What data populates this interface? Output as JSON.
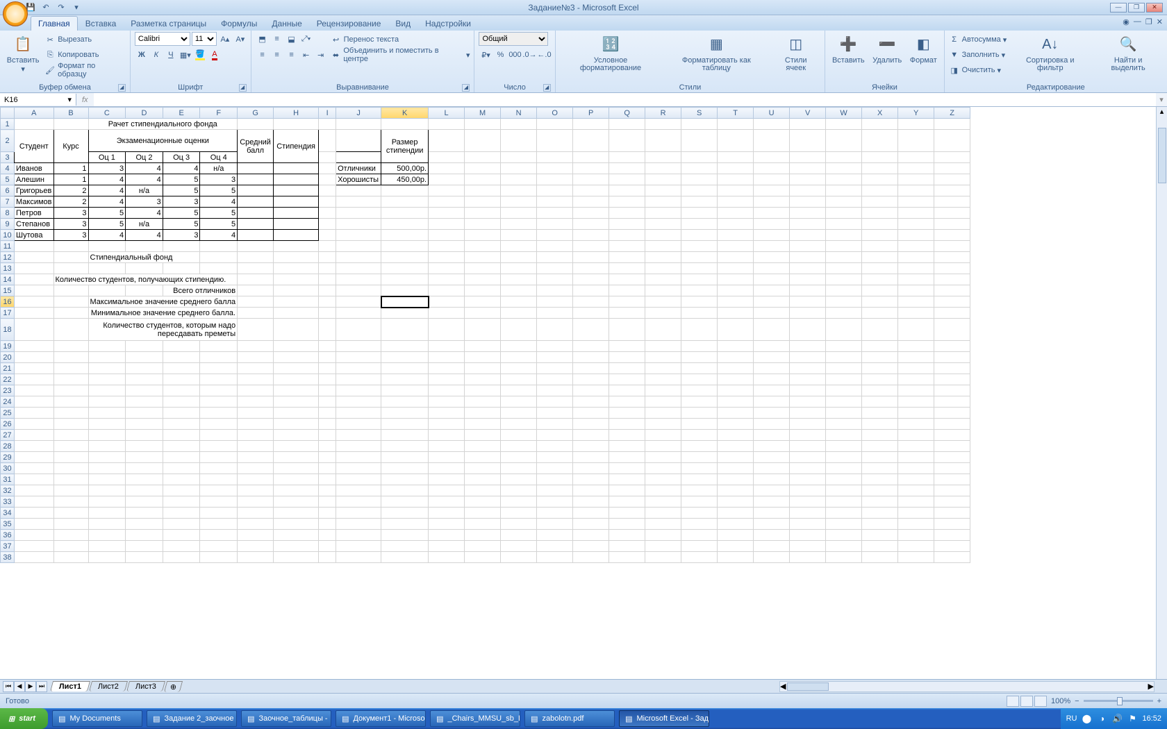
{
  "window": {
    "title": "Задание№3 - Microsoft Excel"
  },
  "qat": {
    "save": "💾",
    "undo": "↶",
    "redo": "↷"
  },
  "tabs": {
    "home": "Главная",
    "insert": "Вставка",
    "layout": "Разметка страницы",
    "formulas": "Формулы",
    "data": "Данные",
    "review": "Рецензирование",
    "view": "Вид",
    "addins": "Надстройки"
  },
  "ribbon": {
    "paste": "Вставить",
    "cut": "Вырезать",
    "copy": "Копировать",
    "formatpainter": "Формат по образцу",
    "clipboard": "Буфер обмена",
    "font": "Шрифт",
    "fontname": "Calibri",
    "fontsize": "11",
    "alignment": "Выравнивание",
    "wrap": "Перенос текста",
    "merge": "Объединить и поместить в центре",
    "number": "Число",
    "numformat": "Общий",
    "styles": "Стили",
    "condformat": "Условное форматирование",
    "formatastable": "Форматировать как таблицу",
    "cellstyles": "Стили ячеек",
    "cells": "Ячейки",
    "insert2": "Вставить",
    "delete": "Удалить",
    "format": "Формат",
    "editing": "Редактирование",
    "autosum": "Автосумма",
    "fill": "Заполнить",
    "clear": "Очистить",
    "sortfilter": "Сортировка и фильтр",
    "findselect": "Найти и выделить"
  },
  "namebox": "K16",
  "columns": [
    "A",
    "B",
    "C",
    "D",
    "E",
    "F",
    "G",
    "H",
    "I",
    "J",
    "K",
    "L",
    "M",
    "N",
    "O",
    "P",
    "Q",
    "R",
    "S",
    "T",
    "U",
    "V",
    "W",
    "X",
    "Y",
    "Z"
  ],
  "selected_col": "K",
  "selected_row": 16,
  "table": {
    "title": "Рачет стипендиального фонда",
    "h_student": "Студент",
    "h_course": "Курс",
    "h_marks": "Экзаменационные оценки",
    "h_avg": "Средний балл",
    "h_stip": "Стипендия",
    "h_o1": "Оц 1",
    "h_o2": "Оц 2",
    "h_o3": "Оц 3",
    "h_o4": "Оц 4",
    "rows": [
      {
        "n": "Иванов",
        "k": 1,
        "o1": 3,
        "o2": 4,
        "o3": 4,
        "o4": "н/а"
      },
      {
        "n": "Алешин",
        "k": 1,
        "o1": 4,
        "o2": 4,
        "o3": 5,
        "o4": 3
      },
      {
        "n": "Григорьев",
        "k": 2,
        "o1": 4,
        "o2": "н/а",
        "o3": 5,
        "o4": 5
      },
      {
        "n": "Максимов",
        "k": 2,
        "o1": 4,
        "o2": 3,
        "o3": 3,
        "o4": 4
      },
      {
        "n": "Петров",
        "k": 3,
        "o1": 5,
        "o2": 4,
        "o3": 5,
        "o4": 5
      },
      {
        "n": "Степанов",
        "k": 3,
        "o1": 5,
        "o2": "н/а",
        "o3": 5,
        "o4": 5
      },
      {
        "n": "Шутова",
        "k": 3,
        "o1": 4,
        "o2": 4,
        "o3": 3,
        "o4": 4
      }
    ]
  },
  "side": {
    "h_size": "Размер стипендии",
    "r1": "Отличники",
    "v1": "500,00р.",
    "r2": "Хорошисты",
    "v2": "450,00р."
  },
  "lbl": {
    "fund": "Стипендиальный фонд",
    "count": "Количество студентов, получающих стипендию.",
    "exc": "Всего отличников",
    "max": "Максимальное значение среднего балла",
    "min": "Минимальное значение среднего балла.",
    "retake1": "Количество студентов, которым надо",
    "retake2": "пересдавать преметы"
  },
  "sheets": {
    "s1": "Лист1",
    "s2": "Лист2",
    "s3": "Лист3"
  },
  "status": "Готово",
  "zoom": "100%",
  "tray": {
    "lang": "RU",
    "time": "16:52"
  },
  "taskbar": {
    "start": "start",
    "items": [
      "My Documents",
      "Задание 2_заочное …",
      "Заочное_таблицы - …",
      "Документ1 - Microso…",
      "_Chairs_MMSU_sb_E…",
      "zabolotn.pdf",
      "Microsoft Excel - Зад…"
    ]
  }
}
